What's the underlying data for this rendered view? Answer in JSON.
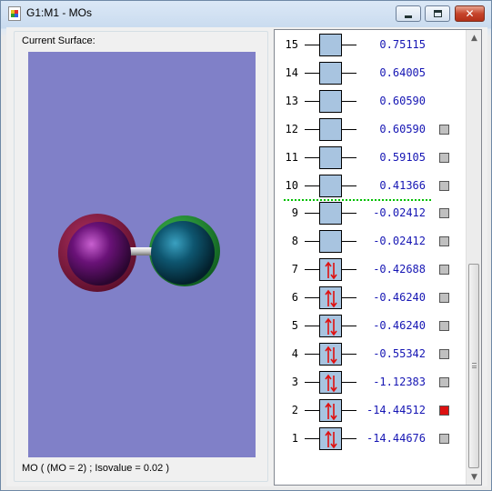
{
  "window": {
    "title": "G1:M1 - MOs"
  },
  "surface_panel": {
    "label": "Current Surface:",
    "caption": "MO ( (MO = 2) ; Isovalue = 0.02 )",
    "background_color": "#8080c8"
  },
  "orbitals": [
    {
      "number": "15",
      "energy": "0.75115",
      "occupied": false,
      "has_checkbox": false,
      "checked": false
    },
    {
      "number": "14",
      "energy": "0.64005",
      "occupied": false,
      "has_checkbox": false,
      "checked": false
    },
    {
      "number": "13",
      "energy": "0.60590",
      "occupied": false,
      "has_checkbox": false,
      "checked": false
    },
    {
      "number": "12",
      "energy": "0.60590",
      "occupied": false,
      "has_checkbox": true,
      "checked": false
    },
    {
      "number": "11",
      "energy": "0.59105",
      "occupied": false,
      "has_checkbox": true,
      "checked": false
    },
    {
      "number": "10",
      "energy": "0.41366",
      "occupied": false,
      "has_checkbox": true,
      "checked": false
    },
    {
      "number": "9",
      "energy": "-0.02412",
      "occupied": false,
      "has_checkbox": true,
      "checked": false
    },
    {
      "number": "8",
      "energy": "-0.02412",
      "occupied": false,
      "has_checkbox": true,
      "checked": false
    },
    {
      "number": "7",
      "energy": "-0.42688",
      "occupied": true,
      "has_checkbox": true,
      "checked": false
    },
    {
      "number": "6",
      "energy": "-0.46240",
      "occupied": true,
      "has_checkbox": true,
      "checked": false
    },
    {
      "number": "5",
      "energy": "-0.46240",
      "occupied": true,
      "has_checkbox": true,
      "checked": false
    },
    {
      "number": "4",
      "energy": "-0.55342",
      "occupied": true,
      "has_checkbox": true,
      "checked": false
    },
    {
      "number": "3",
      "energy": "-1.12383",
      "occupied": true,
      "has_checkbox": true,
      "checked": false
    },
    {
      "number": "2",
      "energy": "-14.44512",
      "occupied": true,
      "has_checkbox": true,
      "checked": true
    },
    {
      "number": "1",
      "energy": "-14.44676",
      "occupied": true,
      "has_checkbox": true,
      "checked": false
    }
  ],
  "colors": {
    "orbital_box": "#a8c4e0",
    "energy_text": "#1616b4",
    "spin_arrow": "#e01010",
    "selected_checkbox": "#dd1111",
    "homo_lumo_divider": "#00c000",
    "atom_left_lobe": "#7a1a80",
    "atom_right_lobe": "#0e4e66"
  },
  "scrollbar": {
    "thumb_position": "bottom"
  }
}
